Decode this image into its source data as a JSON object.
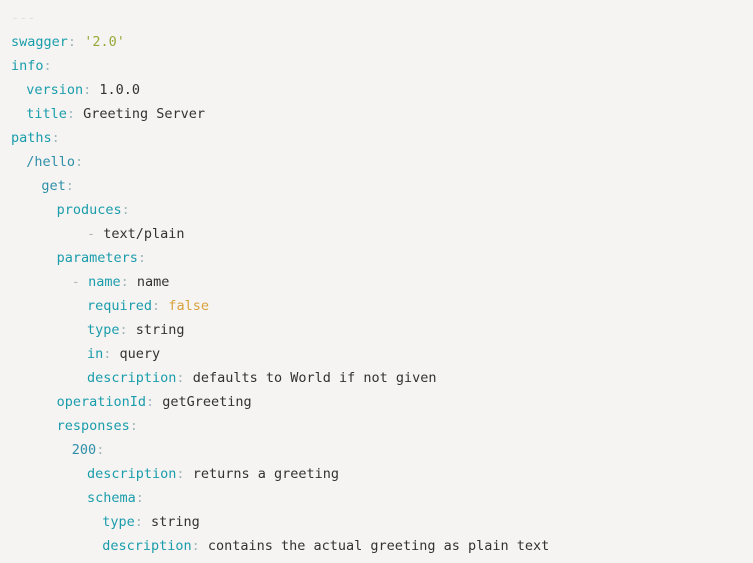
{
  "document": {
    "language": "yaml",
    "background_color": "#f5f4f2",
    "colors": {
      "key": "#1a9dab",
      "path_key": "#2f8fa8",
      "string": "#9aa83a",
      "boolean": "#d9a23b",
      "plain_value": "#33322e",
      "punctuation": "#9fb8bd",
      "dash": "#b9b6b0",
      "doc_separator": "#e3e0dc"
    }
  },
  "lines": [
    {
      "id": "l1",
      "indent": 0,
      "dash": false,
      "doc_sep": "---",
      "key": "",
      "colon": "",
      "value": "",
      "value_kind": "none"
    },
    {
      "id": "l2",
      "indent": 0,
      "dash": false,
      "doc_sep": "",
      "key": "swagger",
      "colon": ":",
      "value": "'2.0'",
      "value_kind": "string"
    },
    {
      "id": "l3",
      "indent": 0,
      "dash": false,
      "doc_sep": "",
      "key": "info",
      "colon": ":",
      "value": "",
      "value_kind": "none"
    },
    {
      "id": "l4",
      "indent": 1,
      "dash": false,
      "doc_sep": "",
      "key": "version",
      "colon": ":",
      "value": "1.0.0",
      "value_kind": "plain"
    },
    {
      "id": "l5",
      "indent": 1,
      "dash": false,
      "doc_sep": "",
      "key": "title",
      "colon": ":",
      "value": "Greeting Server",
      "value_kind": "plain"
    },
    {
      "id": "l6",
      "indent": 0,
      "dash": false,
      "doc_sep": "",
      "key": "paths",
      "colon": ":",
      "value": "",
      "value_kind": "none"
    },
    {
      "id": "l7",
      "indent": 1,
      "dash": false,
      "doc_sep": "",
      "key": "/hello",
      "colon": ":",
      "value": "",
      "value_kind": "none",
      "key_kind": "path"
    },
    {
      "id": "l8",
      "indent": 2,
      "dash": false,
      "doc_sep": "",
      "key": "get",
      "colon": ":",
      "value": "",
      "value_kind": "none",
      "key_kind": "path"
    },
    {
      "id": "l9",
      "indent": 3,
      "dash": false,
      "doc_sep": "",
      "key": "produces",
      "colon": ":",
      "value": "",
      "value_kind": "none"
    },
    {
      "id": "l10",
      "indent": 5,
      "dash": true,
      "doc_sep": "",
      "key": "",
      "colon": "",
      "value": "text/plain",
      "value_kind": "plain"
    },
    {
      "id": "l11",
      "indent": 3,
      "dash": false,
      "doc_sep": "",
      "key": "parameters",
      "colon": ":",
      "value": "",
      "value_kind": "none"
    },
    {
      "id": "l12",
      "indent": 4,
      "dash": true,
      "doc_sep": "",
      "key": "name",
      "colon": ":",
      "value": "name",
      "value_kind": "plain"
    },
    {
      "id": "l13",
      "indent": 5,
      "dash": false,
      "doc_sep": "",
      "key": "required",
      "colon": ":",
      "value": "false",
      "value_kind": "boolean"
    },
    {
      "id": "l14",
      "indent": 5,
      "dash": false,
      "doc_sep": "",
      "key": "type",
      "colon": ":",
      "value": "string",
      "value_kind": "plain"
    },
    {
      "id": "l15",
      "indent": 5,
      "dash": false,
      "doc_sep": "",
      "key": "in",
      "colon": ":",
      "value": "query",
      "value_kind": "plain"
    },
    {
      "id": "l16",
      "indent": 5,
      "dash": false,
      "doc_sep": "",
      "key": "description",
      "colon": ":",
      "value": "defaults to World if not given",
      "value_kind": "plain"
    },
    {
      "id": "l17",
      "indent": 3,
      "dash": false,
      "doc_sep": "",
      "key": "operationId",
      "colon": ":",
      "value": "getGreeting",
      "value_kind": "plain"
    },
    {
      "id": "l18",
      "indent": 3,
      "dash": false,
      "doc_sep": "",
      "key": "responses",
      "colon": ":",
      "value": "",
      "value_kind": "none"
    },
    {
      "id": "l19",
      "indent": 4,
      "dash": false,
      "doc_sep": "",
      "key": "200",
      "colon": ":",
      "value": "",
      "value_kind": "none",
      "key_kind": "number"
    },
    {
      "id": "l20",
      "indent": 5,
      "dash": false,
      "doc_sep": "",
      "key": "description",
      "colon": ":",
      "value": "returns a greeting",
      "value_kind": "plain"
    },
    {
      "id": "l21",
      "indent": 5,
      "dash": false,
      "doc_sep": "",
      "key": "schema",
      "colon": ":",
      "value": "",
      "value_kind": "none"
    },
    {
      "id": "l22",
      "indent": 6,
      "dash": false,
      "doc_sep": "",
      "key": "type",
      "colon": ":",
      "value": "string",
      "value_kind": "plain"
    },
    {
      "id": "l23",
      "indent": 6,
      "dash": false,
      "doc_sep": "",
      "key": "description",
      "colon": ":",
      "value": "contains the actual greeting as plain text",
      "value_kind": "plain"
    }
  ]
}
